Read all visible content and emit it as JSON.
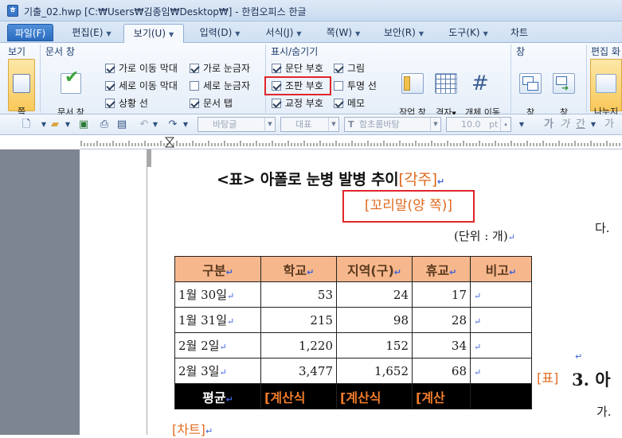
{
  "window": {
    "title": "기출_02.hwp [C:₩Users₩김종임₩Desktop₩] - 한컴오피스 한글",
    "app_icon": "hwp-document-icon"
  },
  "tabs": [
    {
      "label": "파일(F)"
    },
    {
      "label": "편집(E)"
    },
    {
      "label": "보기(U)"
    },
    {
      "label": "입력(D)"
    },
    {
      "label": "서식(J)"
    },
    {
      "label": "쪽(W)"
    },
    {
      "label": "보안(R)"
    },
    {
      "label": "도구(K)"
    },
    {
      "label": "차트"
    }
  ],
  "ribbon": {
    "groups": {
      "view": "보기",
      "doc_window": "문서 창",
      "show_hide": "표시/숨기기",
      "window": "창",
      "edit_window": "편집 화"
    },
    "page_outline": "쪽\n윤곽",
    "doc_window_style": "문서 창\n모양 설정",
    "checks": [
      {
        "label": "가로 이동 막대",
        "checked": true
      },
      {
        "label": "세로 이동 막대",
        "checked": true
      },
      {
        "label": "상황 선",
        "checked": true
      },
      {
        "label": "가로 눈금자",
        "checked": true
      },
      {
        "label": "세로 눈금자",
        "checked": false
      },
      {
        "label": "문서 탭",
        "checked": true
      },
      {
        "label": "문단 부호",
        "checked": true
      },
      {
        "label": "조판 부호",
        "checked": true
      },
      {
        "label": "교정 부호",
        "checked": true
      },
      {
        "label": "그림",
        "checked": true
      },
      {
        "label": "투명 선",
        "checked": false
      },
      {
        "label": "메모",
        "checked": true
      }
    ],
    "btn_hide_work": "작업 창\n숨기기",
    "btn_grid": "격자",
    "btn_obj_move": "개체 이동\n안내선",
    "btn_arrange": "창\n배열",
    "btn_switch": "창\n전환",
    "btn_split": "나누지\n않음"
  },
  "toolbar": {
    "style": "바탕글",
    "lang": "대표",
    "font": "함초롬바탕",
    "size": "10.0",
    "size_unit": "pt",
    "fmt_bold": "가",
    "fmt_italic": "가",
    "fmt_underline": "간",
    "fmt_more": "가"
  },
  "document": {
    "title_main": "<표> 아폴로 눈병 발병 추이",
    "footnote_tag": "[각주]",
    "endnote_tag": "[꼬리말(양 쪽)]",
    "unit": "(단위 : 개)",
    "side_da": "다.",
    "side_table_tag": "[표]",
    "side_heading": "3. 아",
    "side_ga": "가.",
    "chart_tag": "[차트]",
    "table": {
      "headers": [
        "구분",
        "학교",
        "지역(구)",
        "휴교",
        "비고"
      ],
      "rows": [
        [
          "1월 30일",
          "53",
          "24",
          "17",
          ""
        ],
        [
          "1월 31일",
          "215",
          "98",
          "28",
          ""
        ],
        [
          "2월 2일",
          "1,220",
          "152",
          "34",
          ""
        ],
        [
          "2월 3일",
          "3,477",
          "1,652",
          "68",
          ""
        ]
      ],
      "footer": [
        "평균",
        "[계산식",
        "[계산식",
        "[계산",
        ""
      ]
    }
  }
}
